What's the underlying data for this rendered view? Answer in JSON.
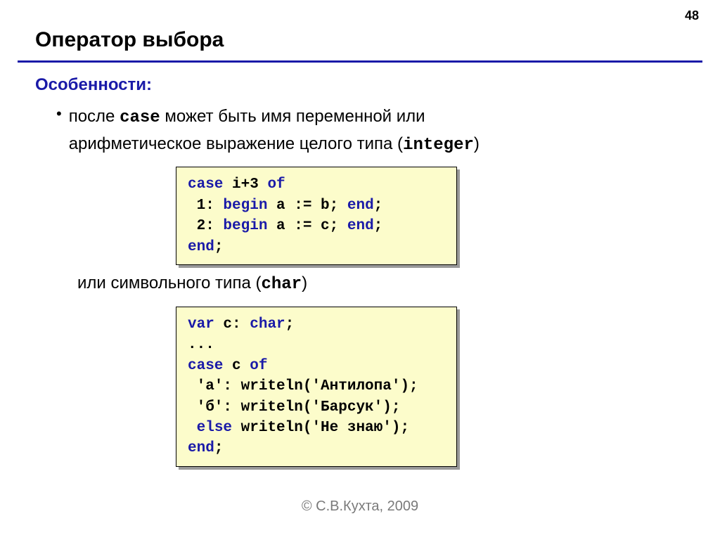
{
  "page_number": "48",
  "title": "Оператор выбора",
  "section_heading": "Особенности:",
  "bullet": {
    "line1_pre": "после ",
    "line1_mono": "case",
    "line1_post": " может быть имя переменной или",
    "line2_pre": "арифметическое выражение целого типа (",
    "line2_mono": "integer",
    "line2_post": ")"
  },
  "code1": {
    "l1a": "case",
    "l1b": " i+3 ",
    "l1c": "of",
    "l2a": " 1: ",
    "l2b": "begin",
    "l2c": " a := b; ",
    "l2d": "end",
    "l2e": ";",
    "l3a": " 2: ",
    "l3b": "begin",
    "l3c": " a := c; ",
    "l3d": "end",
    "l3e": ";",
    "l4a": "end",
    "l4b": ";"
  },
  "midline": {
    "pre": "или символьного типа (",
    "mono": "char",
    "post": ")"
  },
  "code2": {
    "l1a": "var",
    "l1b": " c: ",
    "l1c": "char",
    "l1d": ";",
    "l2": "...",
    "l3a": "case",
    "l3b": " c ",
    "l3c": "of",
    "l4": " 'а': writeln('Антилопа');",
    "l5": " 'б': writeln('Барсук');",
    "l6a": " ",
    "l6b": "else",
    "l6c": " writeln('Не знаю');",
    "l7a": "end",
    "l7b": ";"
  },
  "footer": "© С.В.Кухта, 2009"
}
